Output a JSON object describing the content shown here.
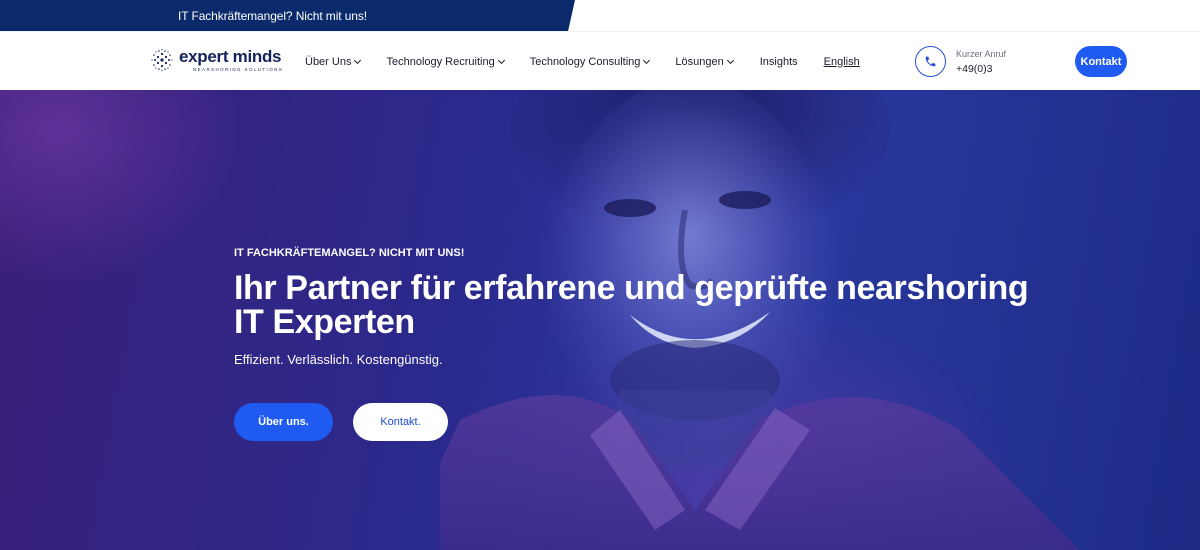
{
  "topbar": {
    "text": "IT Fachkräftemangel? Nicht mit uns!"
  },
  "header": {
    "logo": {
      "name": "expert minds",
      "tagline": "NEARSHORING SOLUTIONS"
    },
    "nav": [
      {
        "label": "Über Uns",
        "dropdown": true
      },
      {
        "label": "Technology Recruiting",
        "dropdown": true
      },
      {
        "label": "Technology Consulting",
        "dropdown": true
      },
      {
        "label": "Lösungen",
        "dropdown": true
      },
      {
        "label": "Insights",
        "dropdown": false
      },
      {
        "label": "English",
        "dropdown": false
      }
    ],
    "call": {
      "label": "Kurzer Anruf",
      "number": "+49(0)3",
      "icon": "phone-icon"
    },
    "contact_button": "Kontakt"
  },
  "hero": {
    "eyebrow": "IT FACHKRÄFTEMANGEL? NICHT MIT UNS!",
    "title_line1": "Ihr Partner für erfahrene und geprüfte nearshoring",
    "title_line2": "IT Experten",
    "subtitle": "Effizient. Verlässlich. Kostengünstig.",
    "primary_button": "Über uns.",
    "secondary_button": "Kontakt."
  },
  "colors": {
    "brand_navy": "#0b2a6b",
    "accent_blue": "#1f5bf0",
    "hero_purple": "#3a1f78",
    "hero_blue": "#2b3aa0"
  }
}
